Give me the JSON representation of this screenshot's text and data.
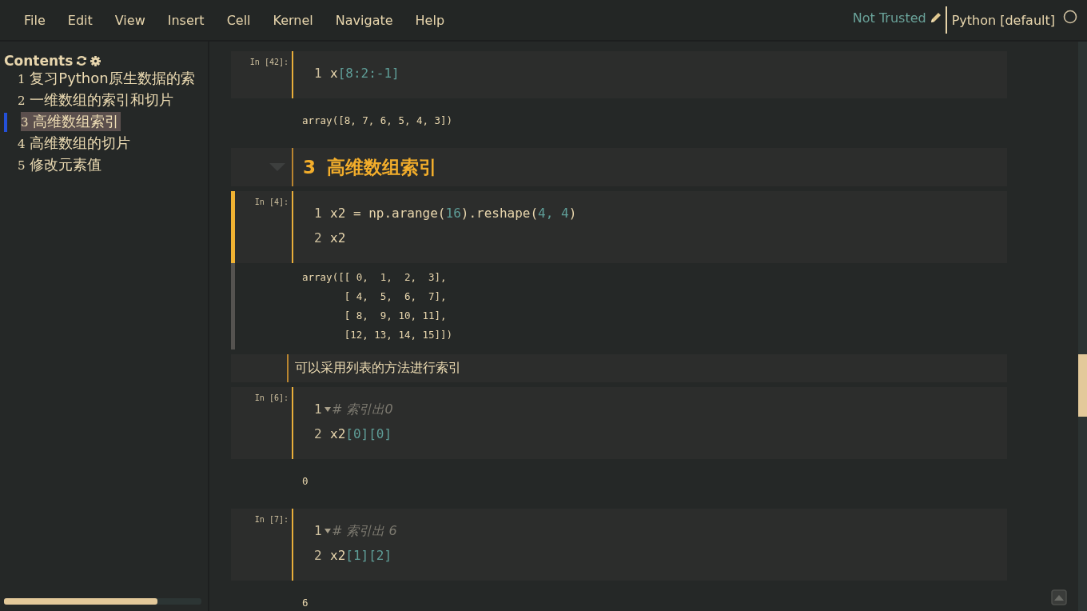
{
  "menu": [
    "File",
    "Edit",
    "View",
    "Insert",
    "Cell",
    "Kernel",
    "Navigate",
    "Help"
  ],
  "status": {
    "trusted": "Not Trusted",
    "kernel": "Python [default]"
  },
  "toc": {
    "title": "Contents",
    "items": [
      {
        "number": "1",
        "label": "复习Python原生数据的索",
        "selected": false
      },
      {
        "number": "2",
        "label": "一维数组的索引和切片",
        "selected": false
      },
      {
        "number": "3",
        "label": "高维数组索引",
        "selected": true
      },
      {
        "number": "4",
        "label": "高维数组的切片",
        "selected": false
      },
      {
        "number": "5",
        "label": "修改元素值",
        "selected": false
      }
    ]
  },
  "cells": [
    {
      "kind": "code",
      "prompt": "In [42]:",
      "selected": false,
      "lines": [
        {
          "number": "1",
          "foldable": false,
          "tokens": [
            {
              "kind": "code",
              "text": "x"
            },
            {
              "kind": "num",
              "text": "[8:2:-1]"
            }
          ]
        }
      ],
      "output": [
        "array([8, 7, 6, 5, 4, 3])"
      ]
    },
    {
      "kind": "heading",
      "number": "3",
      "text": "高维数组索引"
    },
    {
      "kind": "code",
      "prompt": "In [4]:",
      "selected": true,
      "lines": [
        {
          "number": "1",
          "foldable": false,
          "tokens": [
            {
              "kind": "code",
              "text": "x2 = np.arange("
            },
            {
              "kind": "num",
              "text": "16"
            },
            {
              "kind": "code",
              "text": ").reshape("
            },
            {
              "kind": "num",
              "text": "4, 4"
            },
            {
              "kind": "code",
              "text": ")"
            }
          ]
        },
        {
          "number": "2",
          "foldable": false,
          "tokens": [
            {
              "kind": "code",
              "text": "x2"
            }
          ]
        }
      ],
      "output": [
        "array([[ 0,  1,  2,  3],",
        "       [ 4,  5,  6,  7],",
        "       [ 8,  9, 10, 11],",
        "       [12, 13, 14, 15]])"
      ]
    },
    {
      "kind": "markdown",
      "text": "可以采用列表的方法进行索引"
    },
    {
      "kind": "code",
      "prompt": "In [6]:",
      "selected": false,
      "lines": [
        {
          "number": "1",
          "foldable": true,
          "tokens": [
            {
              "kind": "comment",
              "text": "# 索引出0"
            }
          ]
        },
        {
          "number": "2",
          "foldable": false,
          "tokens": [
            {
              "kind": "code",
              "text": "x2"
            },
            {
              "kind": "num",
              "text": "[0][0]"
            }
          ]
        }
      ],
      "output": [
        "0"
      ]
    },
    {
      "kind": "code",
      "prompt": "In [7]:",
      "selected": false,
      "lines": [
        {
          "number": "1",
          "foldable": true,
          "tokens": [
            {
              "kind": "comment",
              "text": "# 索引出 6"
            }
          ]
        },
        {
          "number": "2",
          "foldable": false,
          "tokens": [
            {
              "kind": "code",
              "text": "x2"
            },
            {
              "kind": "num",
              "text": "[1][2]"
            }
          ]
        }
      ],
      "output": [
        "6"
      ]
    }
  ]
}
